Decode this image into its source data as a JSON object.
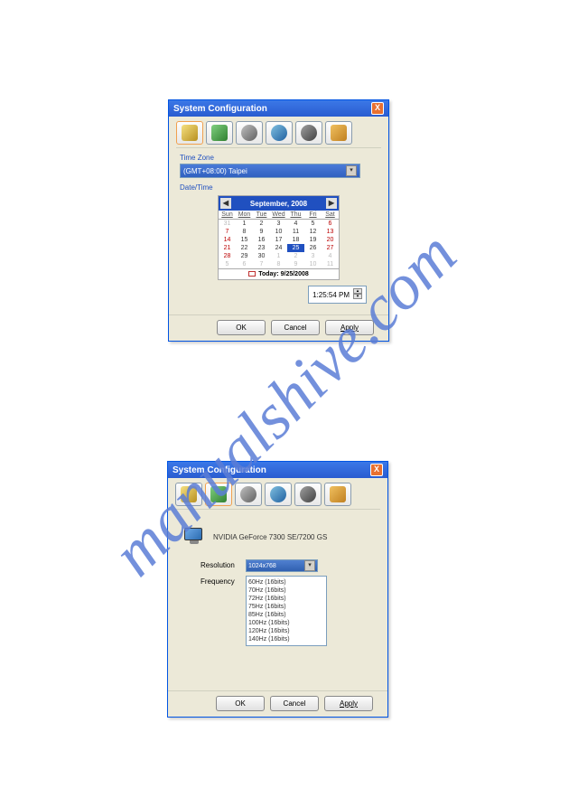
{
  "watermark": "manualshive.com",
  "dialog1": {
    "title": "System Configuration",
    "close": "X",
    "timezone_label": "Time Zone",
    "timezone_value": "(GMT+08:00) Taipei",
    "datetime_label": "Date/Time",
    "cal_month": "September, 2008",
    "day_headers": [
      "Sun",
      "Mon",
      "Tue",
      "Wed",
      "Thu",
      "Fri",
      "Sat"
    ],
    "weeks": [
      [
        {
          "v": "31",
          "c": "gr"
        },
        {
          "v": "1"
        },
        {
          "v": "2"
        },
        {
          "v": "3"
        },
        {
          "v": "4"
        },
        {
          "v": "5"
        },
        {
          "v": "6",
          "c": "rd"
        }
      ],
      [
        {
          "v": "7",
          "c": "rd"
        },
        {
          "v": "8"
        },
        {
          "v": "9"
        },
        {
          "v": "10"
        },
        {
          "v": "11"
        },
        {
          "v": "12"
        },
        {
          "v": "13",
          "c": "rd"
        }
      ],
      [
        {
          "v": "14",
          "c": "rd"
        },
        {
          "v": "15"
        },
        {
          "v": "16"
        },
        {
          "v": "17"
        },
        {
          "v": "18"
        },
        {
          "v": "19"
        },
        {
          "v": "20",
          "c": "rd"
        }
      ],
      [
        {
          "v": "21",
          "c": "rd"
        },
        {
          "v": "22"
        },
        {
          "v": "23"
        },
        {
          "v": "24"
        },
        {
          "v": "25",
          "c": "sel"
        },
        {
          "v": "26"
        },
        {
          "v": "27",
          "c": "rd"
        }
      ],
      [
        {
          "v": "28",
          "c": "rd"
        },
        {
          "v": "29"
        },
        {
          "v": "30"
        },
        {
          "v": "1",
          "c": "gr"
        },
        {
          "v": "2",
          "c": "gr"
        },
        {
          "v": "3",
          "c": "gr"
        },
        {
          "v": "4",
          "c": "gr"
        }
      ],
      [
        {
          "v": "5",
          "c": "gr"
        },
        {
          "v": "6",
          "c": "gr"
        },
        {
          "v": "7",
          "c": "gr"
        },
        {
          "v": "8",
          "c": "gr"
        },
        {
          "v": "9",
          "c": "gr"
        },
        {
          "v": "10",
          "c": "gr"
        },
        {
          "v": "11",
          "c": "gr"
        }
      ]
    ],
    "today_label": "Today: 9/25/2008",
    "time": "1:25:54 PM",
    "ok": "OK",
    "cancel": "Cancel",
    "apply": "Apply"
  },
  "dialog2": {
    "title": "System Configuration",
    "close": "X",
    "gpu": "NVIDIA GeForce 7300 SE/7200 GS",
    "res_label": "Resolution",
    "res_value": "1024x768",
    "freq_label": "Frequency",
    "freq_options": [
      "60Hz (16bits)",
      "70Hz (16bits)",
      "72Hz (16bits)",
      "75Hz (16bits)",
      "85Hz (16bits)",
      "100Hz (16bits)",
      "120Hz (16bits)",
      "140Hz (16bits)"
    ],
    "ok": "OK",
    "cancel": "Cancel",
    "apply": "Apply"
  }
}
